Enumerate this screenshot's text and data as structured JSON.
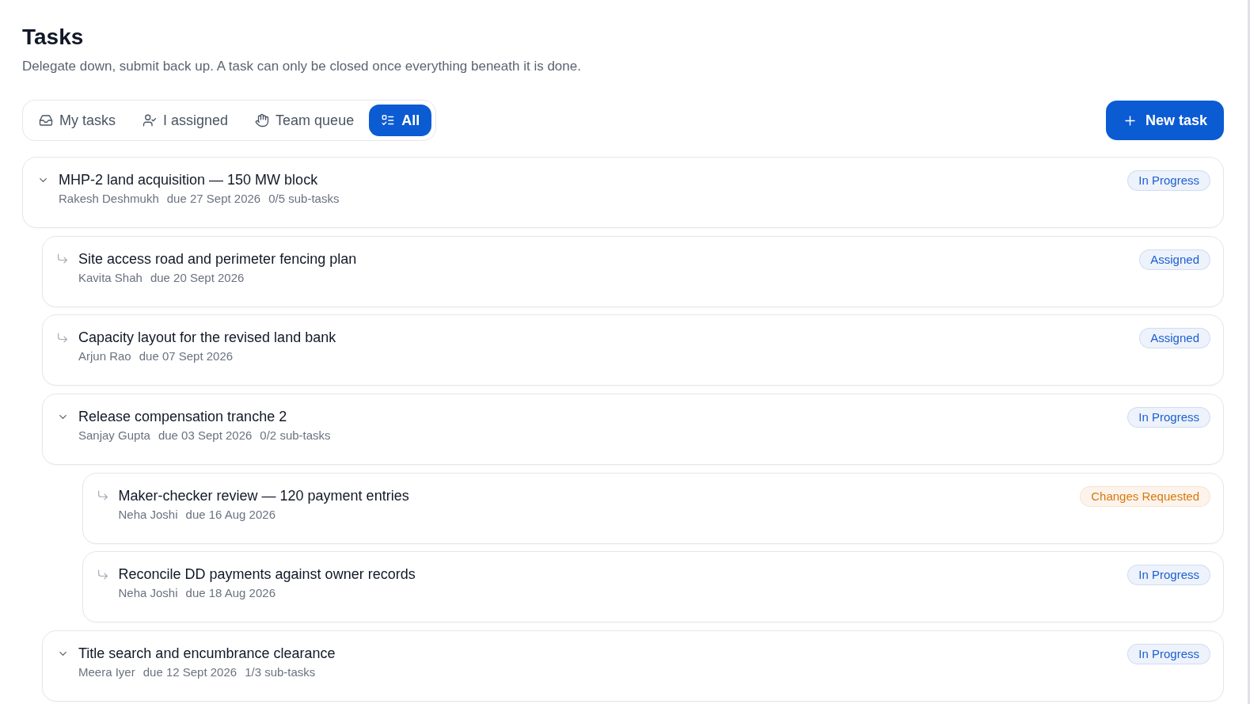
{
  "header": {
    "title": "Tasks",
    "subtitle": "Delegate down, submit back up. A task can only be closed once everything beneath it is done."
  },
  "tabs": [
    {
      "label": "My tasks",
      "selected": false
    },
    {
      "label": "I assigned",
      "selected": false
    },
    {
      "label": "Team queue",
      "selected": false
    },
    {
      "label": "All",
      "selected": true
    }
  ],
  "new_task_button": {
    "label": "New task"
  },
  "tasks": [
    {
      "kind": "group",
      "expanded": true,
      "title": "MHP-2 land acquisition — 150 MW block",
      "assignee": "Rakesh Deshmukh",
      "due": "due 27 Sept 2026",
      "subtasks": "0/5 sub-tasks",
      "status": "In Progress",
      "color": "#1b5fd1",
      "children": [
        {
          "kind": "leaf",
          "title": "Site access road and perimeter fencing plan",
          "assignee": "Kavita Shah",
          "due": "due 20 Sept 2026",
          "status": "Assigned",
          "color": "#1b5fd1"
        },
        {
          "kind": "leaf",
          "title": "Capacity layout for the revised land bank",
          "assignee": "Arjun Rao",
          "due": "due 07 Sept 2026",
          "status": "Assigned",
          "color": "#1b5fd1"
        },
        {
          "kind": "group",
          "expanded": true,
          "title": "Release compensation tranche 2",
          "assignee": "Sanjay Gupta",
          "due": "due 03 Sept 2026",
          "subtasks": "0/2 sub-tasks",
          "status": "In Progress",
          "color": "#1b5fd1",
          "children": [
            {
              "kind": "leaf",
              "title": "Maker-checker review — 120 payment entries",
              "assignee": "Neha Joshi",
              "due": "due 16 Aug 2026",
              "status": "Changes Requested",
              "color": "#d9770b"
            },
            {
              "kind": "leaf",
              "title": "Reconcile DD payments against owner records",
              "assignee": "Neha Joshi",
              "due": "due 18 Aug 2026",
              "status": "In Progress",
              "color": "#1b5fd1"
            }
          ]
        },
        {
          "kind": "group",
          "expanded": true,
          "title": "Title search and encumbrance clearance",
          "assignee": "Meera Iyer",
          "due": "due 12 Sept 2026",
          "subtasks": "1/3 sub-tasks",
          "status": "In Progress",
          "color": "#1b5fd1"
        }
      ]
    }
  ]
}
